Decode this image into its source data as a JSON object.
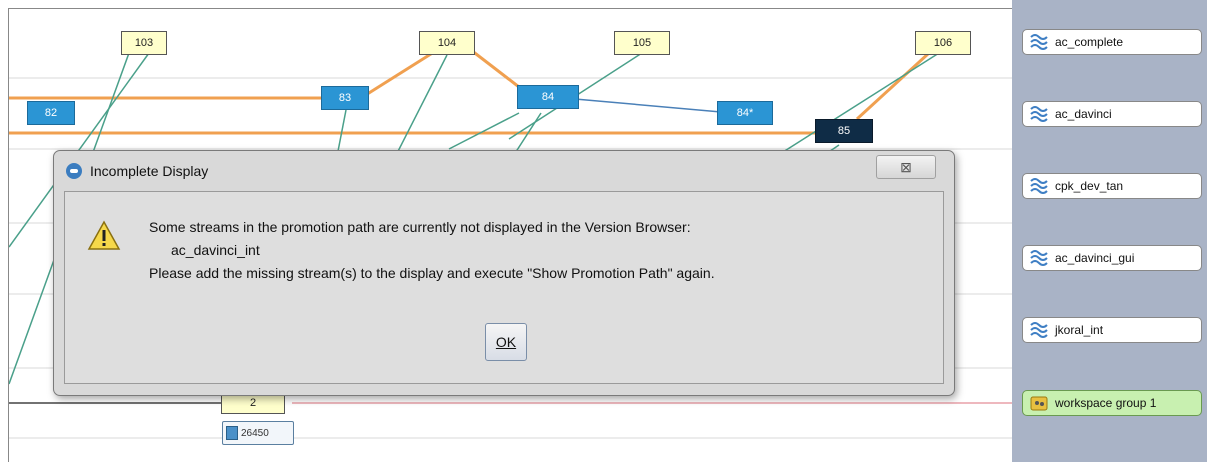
{
  "version_nodes": [
    {
      "label": "103",
      "style": "yellow"
    },
    {
      "label": "104",
      "style": "yellow"
    },
    {
      "label": "105",
      "style": "yellow"
    },
    {
      "label": "106",
      "style": "yellow"
    },
    {
      "label": "82",
      "style": "blue"
    },
    {
      "label": "83",
      "style": "blue"
    },
    {
      "label": "84",
      "style": "blue"
    },
    {
      "label": "84*",
      "style": "blue"
    },
    {
      "label": "85",
      "style": "dark"
    },
    {
      "label": "2",
      "style": "yellow"
    }
  ],
  "baseline": {
    "label": "26450",
    "icon": "document-icon"
  },
  "streams": [
    {
      "label": "ac_complete",
      "icon": "stream-icon"
    },
    {
      "label": "ac_davinci",
      "icon": "stream-icon"
    },
    {
      "label": "cpk_dev_tan",
      "icon": "stream-icon"
    },
    {
      "label": "ac_davinci_gui",
      "icon": "stream-icon"
    },
    {
      "label": "jkoral_int",
      "icon": "stream-icon"
    },
    {
      "label": "workspace group 1",
      "icon": "workspace-group-icon"
    }
  ],
  "dialog": {
    "title": "Incomplete Display",
    "close_glyph": "⊠",
    "message_line1": "Some streams in the promotion path are currently not displayed in the Version Browser:",
    "missing_stream": "ac_davinci_int",
    "message_line3": "Please add the missing stream(s) to the display and execute \"Show Promotion Path\" again.",
    "ok_label": "OK"
  },
  "colors": {
    "promotion_line": "#f0a050",
    "link_line": "#4aa08a",
    "version_yellow": "#ffffcc",
    "version_blue": "#2b95d4",
    "version_dark": "#0f2c46",
    "sidebar": "#a9b3c6",
    "workspace_group": "#c8f0b0"
  }
}
